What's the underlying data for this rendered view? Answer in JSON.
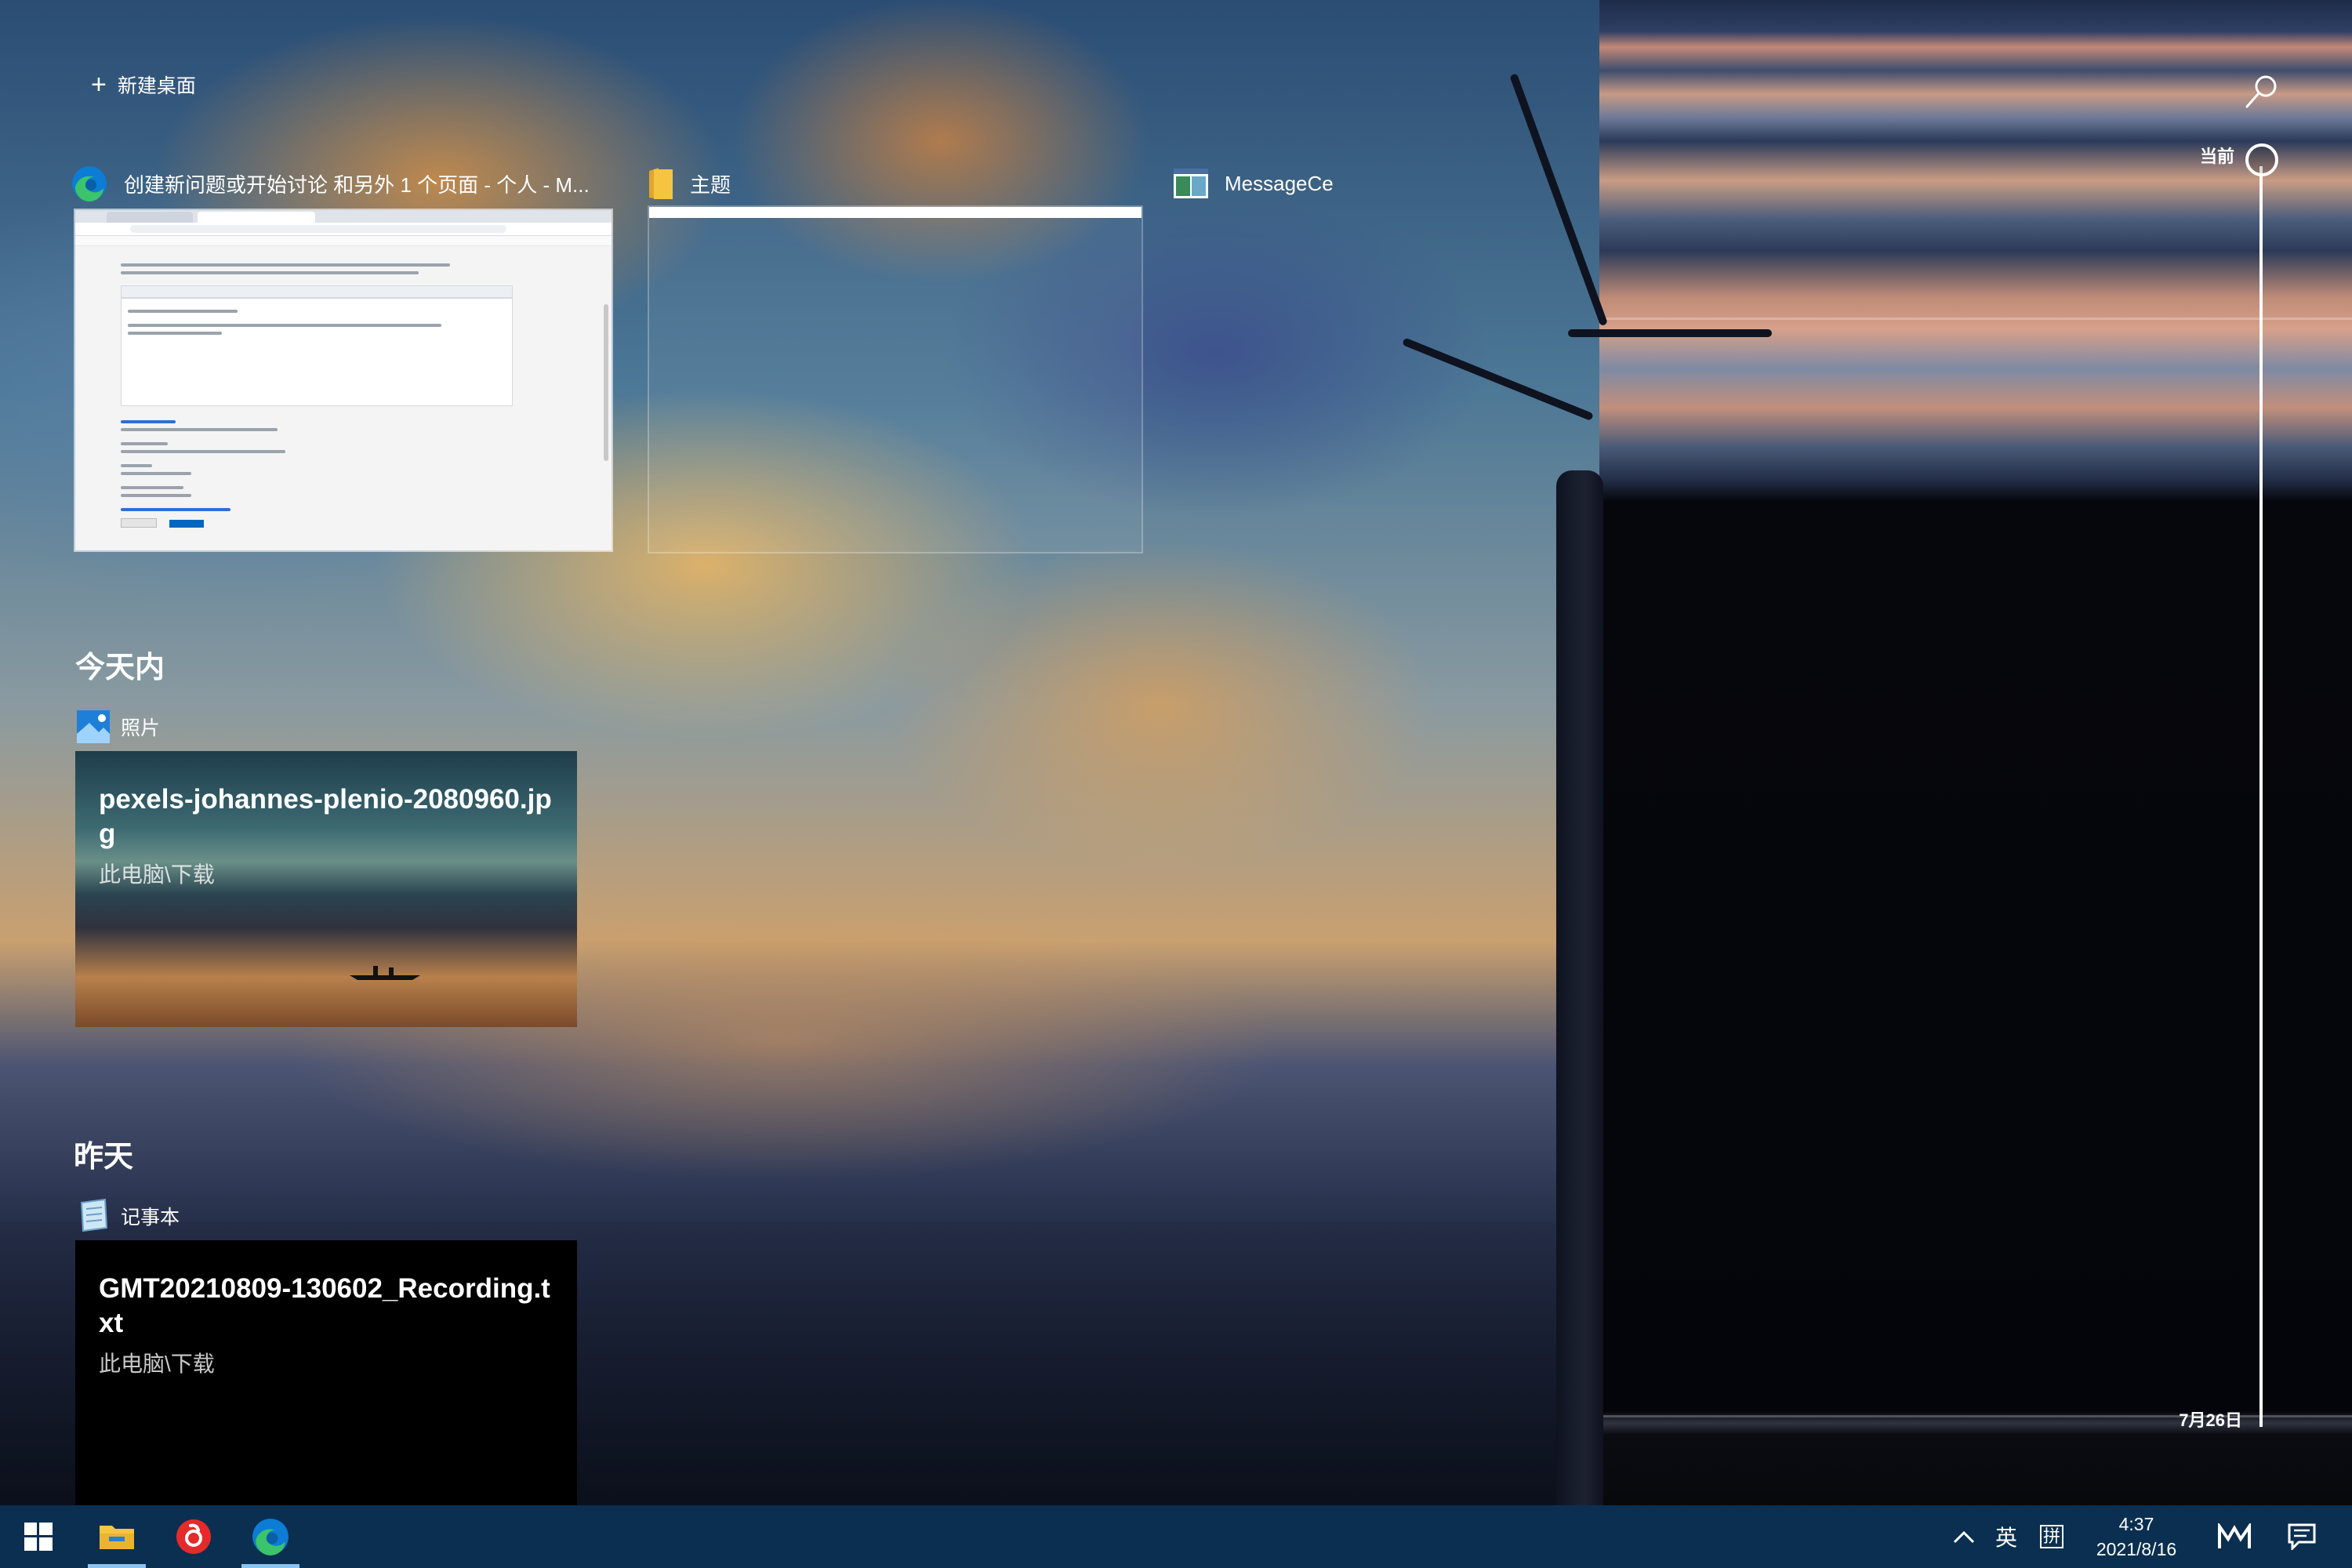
{
  "top": {
    "new_desktop_label": "新建桌面"
  },
  "windows": [
    {
      "title": "创建新问题或开始讨论 和另外 1 个页面 - 个人 - M...",
      "icon": "edge-icon"
    },
    {
      "title": "主题",
      "icon": "folder-icon"
    },
    {
      "title": "MessageCe",
      "icon": "app-window-icon"
    }
  ],
  "sections": {
    "today": {
      "label": "今天内",
      "app_name": "照片",
      "card_title": "pexels-johannes-plenio-2080960.jpg",
      "card_location": "此电脑\\下载"
    },
    "yesterday": {
      "label": "昨天",
      "app_name": "记事本",
      "card_title": "GMT20210809-130602_Recording.txt",
      "card_location": "此电脑\\下载"
    }
  },
  "timeline": {
    "current_label": "当前",
    "date_label": "7月26日"
  },
  "taskbar": {
    "ime_mode": "英",
    "ime_layout": "拼",
    "time": "4:37",
    "date": "2021/8/16"
  },
  "colors": {
    "taskbar": "#0b2f50",
    "accent": "#8cc4f0",
    "edge_blue": "#0c7cd5",
    "edge_green": "#3bc46b",
    "folder_yellow": "#f5c542",
    "netease_red": "#e42b2b"
  }
}
